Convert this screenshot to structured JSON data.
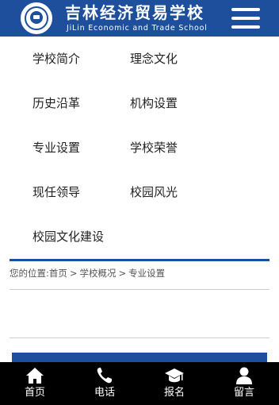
{
  "header": {
    "school_name_cn": "吉林经济贸易学校",
    "school_name_en": "JiLin Economic and Trade School",
    "logo_icon": "school-seal-icon",
    "menu_icon": "hamburger-menu-icon"
  },
  "submenu": {
    "items": [
      {
        "label": "学校简介"
      },
      {
        "label": "理念文化"
      },
      {
        "label": "历史沿革"
      },
      {
        "label": "机构设置"
      },
      {
        "label": "专业设置"
      },
      {
        "label": "学校荣誉"
      },
      {
        "label": "现任领导"
      },
      {
        "label": "校园风光"
      },
      {
        "label": "校园文化建设"
      }
    ]
  },
  "breadcrumb": {
    "prefix": "您的位置:",
    "home": "首页",
    "separator": ">",
    "section": "学校概况",
    "current": "专业设置"
  },
  "bottom_nav": {
    "items": [
      {
        "label": "首页",
        "icon": "home-icon"
      },
      {
        "label": "电话",
        "icon": "phone-icon"
      },
      {
        "label": "报名",
        "icon": "graduation-cap-icon"
      },
      {
        "label": "留言",
        "icon": "user-icon"
      }
    ]
  },
  "colors": {
    "brand_blue": "#1d4f9d",
    "bottom_nav_bg": "#000000",
    "text": "#222222"
  }
}
